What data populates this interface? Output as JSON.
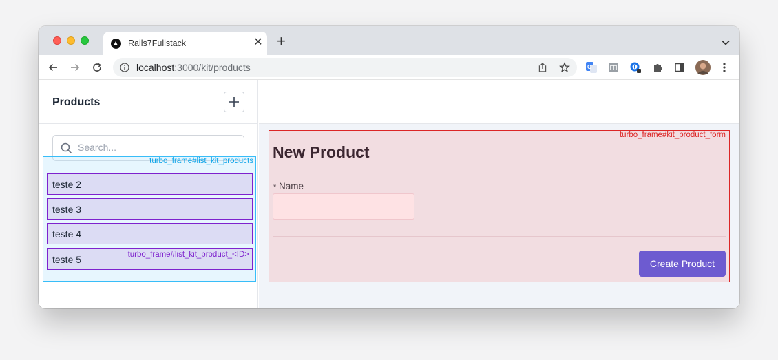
{
  "browser": {
    "tab_title": "Rails7Fullstack",
    "tab_close": "✕",
    "new_tab": "+",
    "url_host": "localhost",
    "url_path": ":3000/kit/products"
  },
  "sidebar": {
    "title": "Products",
    "search_placeholder": "Search...",
    "list_frame_label": "turbo_frame#list_kit_products",
    "item_frame_label": "turbo_frame#list_kit_product_<ID>",
    "items": [
      {
        "label": "teste 2"
      },
      {
        "label": "teste 3"
      },
      {
        "label": "teste 4"
      },
      {
        "label": "teste 5"
      }
    ]
  },
  "form": {
    "frame_label": "turbo_frame#kit_product_form",
    "title": "New Product",
    "required_mark": "*",
    "name_label": "Name",
    "name_value": "",
    "submit_label": "Create Product"
  },
  "colors": {
    "accent": "#6d5bd0",
    "frame_list": "#38bdf8",
    "frame_item": "#7e22ce",
    "frame_form": "#dc2626"
  }
}
